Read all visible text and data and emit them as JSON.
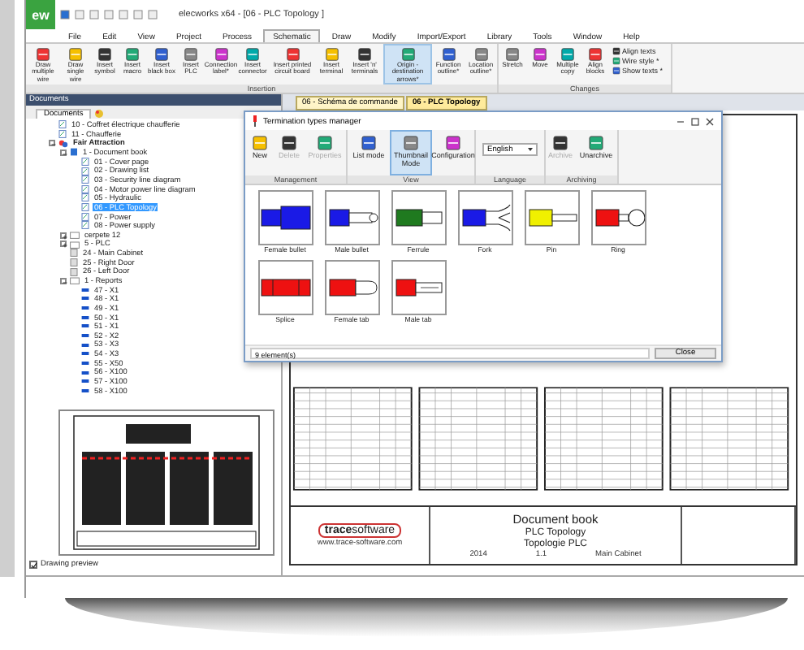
{
  "window": {
    "title": "elecworks x64 - [06 - PLC Topology ]",
    "logo": "ew"
  },
  "menu": [
    {
      "label": "File",
      "selected": false
    },
    {
      "label": "Edit",
      "selected": false
    },
    {
      "label": "View",
      "selected": false
    },
    {
      "label": "Project",
      "selected": false
    },
    {
      "label": "Process",
      "selected": false
    },
    {
      "label": "Schematic",
      "selected": true
    },
    {
      "label": "Draw",
      "selected": false
    },
    {
      "label": "Modify",
      "selected": false
    },
    {
      "label": "Import/Export",
      "selected": false
    },
    {
      "label": "Library",
      "selected": false
    },
    {
      "label": "Tools",
      "selected": false
    },
    {
      "label": "Window",
      "selected": false
    },
    {
      "label": "Help",
      "selected": false
    }
  ],
  "ribbon": {
    "groups": [
      {
        "label": "Insertion",
        "buttons": [
          {
            "label": "Draw multiple wire",
            "selected": false
          },
          {
            "label": "Draw single wire",
            "selected": false
          },
          {
            "label": "Insert symbol",
            "selected": false
          },
          {
            "label": "Insert macro",
            "selected": false
          },
          {
            "label": "Insert black box",
            "selected": false
          },
          {
            "label": "Insert PLC",
            "selected": false
          },
          {
            "label": "Connection label*",
            "selected": false
          },
          {
            "label": "Insert connector",
            "selected": false
          },
          {
            "label": "Insert printed circuit board",
            "selected": false
          },
          {
            "label": "Insert terminal",
            "selected": false
          },
          {
            "label": "Insert 'n' terminals",
            "selected": false
          },
          {
            "label": "Origin - destination arrows*",
            "selected": true
          },
          {
            "label": "Function outline*",
            "selected": false
          },
          {
            "label": "Location outline*",
            "selected": false
          }
        ]
      },
      {
        "label": "Changes",
        "buttons": [
          {
            "label": "Stretch",
            "selected": false
          },
          {
            "label": "Move",
            "selected": false
          },
          {
            "label": "Multiple copy",
            "selected": false
          },
          {
            "label": "Align blocks",
            "selected": false
          }
        ],
        "small_buttons": [
          "Align texts",
          "Wire style *",
          "Show texts *"
        ]
      }
    ]
  },
  "documents": {
    "title": "Documents",
    "tab": "Documents",
    "tree": [
      {
        "label": "10 - Coffret électrique chaufferie",
        "kind": "page",
        "selected": false
      },
      {
        "label": "11 - Chaufferie",
        "kind": "page",
        "selected": false
      },
      {
        "label": "Fair Attraction",
        "kind": "project",
        "expanded": true,
        "selected": false,
        "children": [
          {
            "label": "1 - Document book",
            "kind": "book",
            "expanded": true,
            "selected": false,
            "children": [
              {
                "label": "01 - Cover page",
                "kind": "page",
                "selected": false
              },
              {
                "label": "02 - Drawing list",
                "kind": "page",
                "selected": false
              },
              {
                "label": "03 - Security line diagram",
                "kind": "page",
                "selected": false
              },
              {
                "label": "04 - Motor power line diagram",
                "kind": "page",
                "selected": false
              },
              {
                "label": "05 - Hydraulic",
                "kind": "page",
                "selected": false
              },
              {
                "label": "06 - PLC Topology",
                "kind": "page",
                "selected": true
              },
              {
                "label": "07 - Power",
                "kind": "page",
                "selected": false
              },
              {
                "label": "08 - Power supply",
                "kind": "page",
                "selected": false
              }
            ]
          },
          {
            "label": "cerpete 12",
            "kind": "folder",
            "expanded": false,
            "selected": false
          },
          {
            "label": "5 - PLC",
            "kind": "folder",
            "expanded": false,
            "selected": false
          },
          {
            "label": "24 - Main Cabinet",
            "kind": "cabinet",
            "selected": false
          },
          {
            "label": "25 - Right Door",
            "kind": "cabinet",
            "selected": false
          },
          {
            "label": "26 - Left Door",
            "kind": "cabinet",
            "selected": false
          },
          {
            "label": "1 - Reports",
            "kind": "folder",
            "expanded": true,
            "selected": false,
            "children": [
              {
                "label": "47 - X1",
                "kind": "terminal",
                "selected": false
              },
              {
                "label": "48 - X1",
                "kind": "terminal",
                "selected": false
              },
              {
                "label": "49 - X1",
                "kind": "terminal",
                "selected": false
              },
              {
                "label": "50 - X1",
                "kind": "terminal",
                "selected": false
              },
              {
                "label": "51 - X1",
                "kind": "terminal",
                "selected": false
              },
              {
                "label": "52 - X2",
                "kind": "terminal",
                "selected": false
              },
              {
                "label": "53 - X3",
                "kind": "terminal",
                "selected": false
              },
              {
                "label": "54 - X3",
                "kind": "terminal",
                "selected": false
              },
              {
                "label": "55 - X50",
                "kind": "terminal",
                "selected": false
              },
              {
                "label": "56 - X100",
                "kind": "terminal",
                "selected": false
              },
              {
                "label": "57 - X100",
                "kind": "terminal",
                "selected": false
              },
              {
                "label": "58 - X100",
                "kind": "terminal",
                "selected": false
              }
            ]
          }
        ]
      }
    ],
    "preview_checkbox": {
      "label": "Drawing preview",
      "checked": true
    }
  },
  "doc_tabs": [
    {
      "label": "06 - Schéma de commande",
      "selected": false
    },
    {
      "label": "06 - PLC Topology",
      "selected": true
    }
  ],
  "title_block": {
    "logo_bold": "trace",
    "logo_light": "software",
    "website": "www.trace-software.com",
    "title": "Document book",
    "subtitle_1": "PLC Topology",
    "subtitle_2": "Topologie PLC",
    "year": "2014",
    "sheet": "1.1",
    "location": "Main Cabinet"
  },
  "dialog": {
    "title": "Termination types manager",
    "groups": [
      {
        "label": "Management",
        "buttons": [
          {
            "label": "New",
            "disabled": false,
            "selected": false
          },
          {
            "label": "Delete",
            "disabled": true,
            "selected": false
          },
          {
            "label": "Properties",
            "disabled": true,
            "selected": false
          }
        ]
      },
      {
        "label": "View",
        "buttons": [
          {
            "label": "List mode",
            "disabled": false,
            "selected": false
          },
          {
            "label": "Thumbnail Mode",
            "disabled": false,
            "selected": true
          },
          {
            "label": "Configuration",
            "disabled": false,
            "selected": false
          }
        ]
      },
      {
        "label": "Language",
        "select": "English"
      },
      {
        "label": "Archiving",
        "buttons": [
          {
            "label": "Archive",
            "disabled": true,
            "selected": false
          },
          {
            "label": "Unarchive",
            "disabled": false,
            "selected": false
          }
        ]
      }
    ],
    "items": [
      {
        "label": "Female bullet",
        "kind": "female_bullet",
        "color": "#1a1ae6"
      },
      {
        "label": "Male bullet",
        "kind": "male_bullet",
        "color": "#1a1ae6"
      },
      {
        "label": "Ferrule",
        "kind": "ferrule",
        "color": "#1f7a1f"
      },
      {
        "label": "Fork",
        "kind": "fork",
        "color": "#1a1ae6"
      },
      {
        "label": "Pin",
        "kind": "pin",
        "color": "#f0f000"
      },
      {
        "label": "Ring",
        "kind": "ring",
        "color": "#ee1111"
      },
      {
        "label": "Splice",
        "kind": "splice",
        "color": "#ee1111"
      },
      {
        "label": "Female tab",
        "kind": "female_tab",
        "color": "#ee1111"
      },
      {
        "label": "Male tab",
        "kind": "male_tab",
        "color": "#ee1111"
      }
    ],
    "status": "9 element(s)",
    "close": "Close"
  }
}
